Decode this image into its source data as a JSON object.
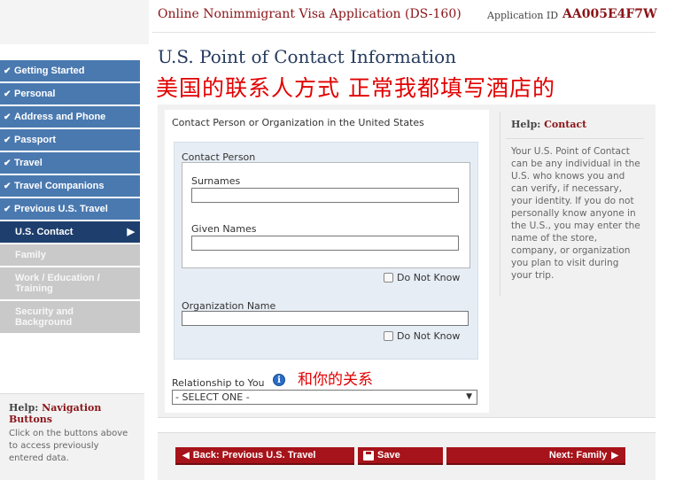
{
  "header": {
    "app_title": "Online Nonimmigrant Visa Application (DS-160)",
    "app_id_label": "Application ID",
    "app_id": "AA005E4F7W"
  },
  "sidebar": {
    "items": [
      {
        "label": "Getting Started",
        "state": "done"
      },
      {
        "label": "Personal",
        "state": "done"
      },
      {
        "label": "Address and Phone",
        "state": "done"
      },
      {
        "label": "Passport",
        "state": "done"
      },
      {
        "label": "Travel",
        "state": "done"
      },
      {
        "label": "Travel Companions",
        "state": "done"
      },
      {
        "label": "Previous U.S. Travel",
        "state": "done"
      },
      {
        "label": "U.S. Contact",
        "state": "current"
      },
      {
        "label": "Family",
        "state": "future"
      },
      {
        "label": "Work / Education / Training",
        "state": "future"
      },
      {
        "label": "Security and Background",
        "state": "future"
      }
    ],
    "help": {
      "prefix": "Help:",
      "title": "Navigation Buttons",
      "body": "Click on the buttons above to access previously entered data."
    }
  },
  "main": {
    "title": "U.S. Point of Contact Information",
    "annotation_top": "美国的联系人方式 正常我都填写酒店的",
    "section_label": "Contact Person or Organization in the United States",
    "contact_person_label": "Contact Person",
    "surnames_label": "Surnames",
    "surnames_value": "",
    "given_names_label": "Given Names",
    "given_names_value": "",
    "do_not_know_1": "Do Not Know",
    "org_name_label": "Organization Name",
    "org_name_value": "",
    "do_not_know_2": "Do Not Know",
    "relationship_label": "Relationship to You",
    "relationship_info_icon": "i",
    "annotation_relationship": "和你的关系",
    "relationship_selected": "- SELECT ONE -"
  },
  "help_contact": {
    "prefix": "Help:",
    "title": "Contact",
    "body": "Your U.S. Point of Contact can be any individual in the U.S. who knows you and can verify, if necessary, your identity. If you do not personally know anyone in the U.S., you may enter the name of the store, company, or organization you plan to visit during your trip."
  },
  "buttons": {
    "back": "Back: Previous U.S. Travel",
    "save": "Save",
    "next": "Next: Family"
  },
  "colors": {
    "brand_red": "#a7131a",
    "nav_done": "#4a79b0",
    "nav_current": "#1e3f6e",
    "nav_future": "#c9c9c9",
    "annotation": "#e20000"
  }
}
